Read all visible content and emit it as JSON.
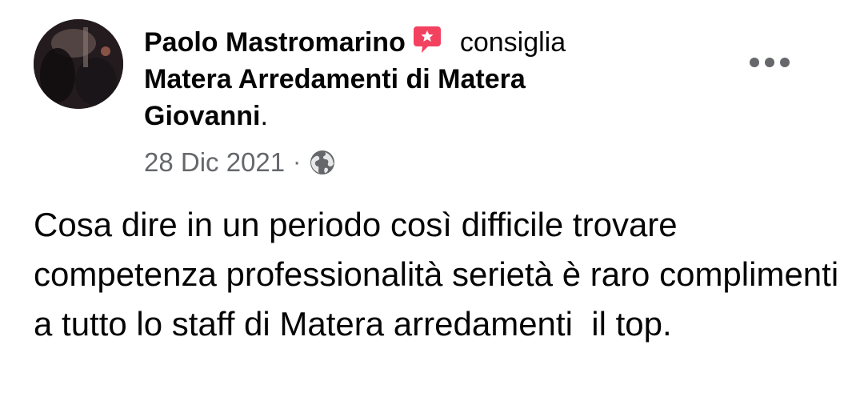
{
  "post": {
    "author_name": "Paolo Mastromarino",
    "action": "consiglia",
    "page_name": "Matera Arredamenti di Matera Giovanni",
    "page_name_suffix": ".",
    "date": "28 Dic 2021",
    "separator": "·",
    "privacy_icon": "globe-icon",
    "recommend_icon": "recommend-star-bubble-icon",
    "more_icon": "more-dots-icon",
    "body": "Cosa dire in un periodo così difficile trovare competenza professionalità serietà è raro complimenti a tutto lo staff di Matera arredamenti  il top."
  },
  "colors": {
    "recommend_pink": "#f3425f",
    "secondary_text": "#65676b",
    "primary_text": "#050505"
  }
}
